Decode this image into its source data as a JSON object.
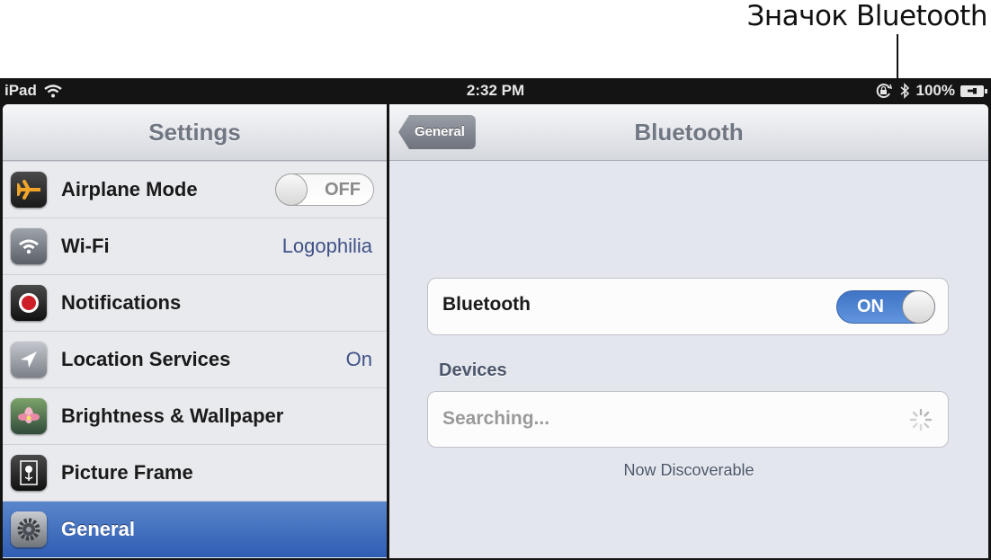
{
  "annotation": {
    "label": "Значок Bluetooth"
  },
  "status_bar": {
    "device": "iPad",
    "time": "2:32 PM",
    "battery": "100%",
    "icons": [
      "wifi-icon",
      "rotation-lock-icon",
      "bluetooth-icon",
      "battery-charging-icon"
    ]
  },
  "sidebar": {
    "title": "Settings",
    "items": [
      {
        "label": "Airplane Mode",
        "icon": "airplane-icon",
        "toggle": "OFF"
      },
      {
        "label": "Wi-Fi",
        "icon": "wifi-icon",
        "value": "Logophilia"
      },
      {
        "label": "Notifications",
        "icon": "notifications-icon"
      },
      {
        "label": "Location Services",
        "icon": "location-arrow-icon",
        "value": "On"
      },
      {
        "label": "Brightness & Wallpaper",
        "icon": "flower-wallpaper-icon"
      },
      {
        "label": "Picture Frame",
        "icon": "picture-frame-icon"
      },
      {
        "label": "General",
        "icon": "gear-icon",
        "selected": true
      }
    ]
  },
  "detail": {
    "back_label": "General",
    "title": "Bluetooth",
    "bluetooth_row": {
      "label": "Bluetooth",
      "toggle": "ON"
    },
    "devices_header": "Devices",
    "searching_label": "Searching...",
    "footer_note": "Now Discoverable"
  },
  "colors": {
    "selected_row": "#3f6dbf",
    "toggle_on": "#4a7fcf",
    "detail_value": "#3f5186"
  }
}
